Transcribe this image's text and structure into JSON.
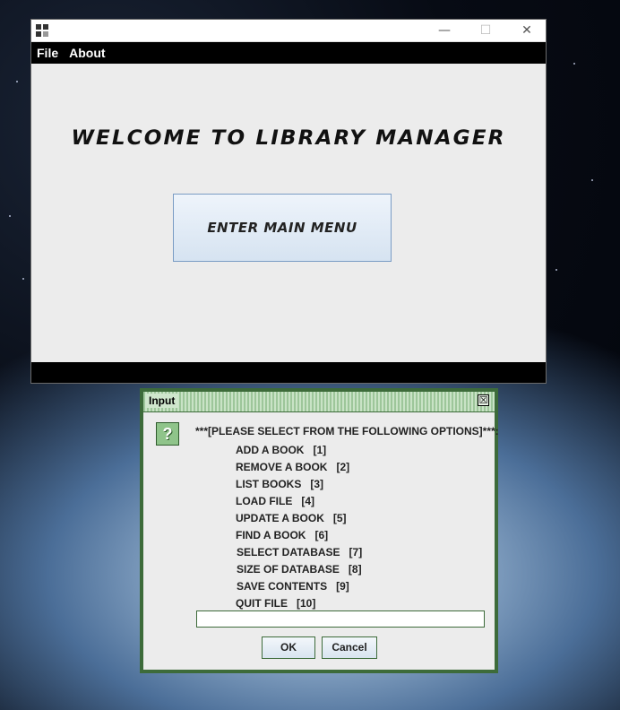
{
  "main_window": {
    "window_controls": {
      "minimize": "—",
      "maximize": "☐",
      "close": "✕"
    },
    "menu": [
      "File",
      "About"
    ],
    "welcome_text": "WELCOME TO LIBRARY MANAGER",
    "enter_button_label": "ENTER MAIN MENU"
  },
  "dialog": {
    "title": "Input",
    "close_glyph": "☒",
    "question_icon": "question-icon",
    "prompt": "***[PLEASE SELECT FROM THE FOLLOWING OPTIONS]***:",
    "options": [
      "ADD A BOOK   [1]",
      "REMOVE A BOOK   [2]",
      "LIST BOOKS   [3]",
      "LOAD FILE   [4]",
      "UPDATE A BOOK   [5]",
      "FIND A BOOK   [6]",
      "SELECT DATABASE   [7]",
      "SIZE OF DATABASE   [8]",
      "SAVE CONTENTS   [9]",
      "QUIT FILE   [10]"
    ],
    "input_value": "",
    "ok_label": "OK",
    "cancel_label": "Cancel"
  },
  "colors": {
    "dialog_border": "#3d6b3a",
    "menubar": "#000000",
    "button_border": "#7a9cc4"
  }
}
